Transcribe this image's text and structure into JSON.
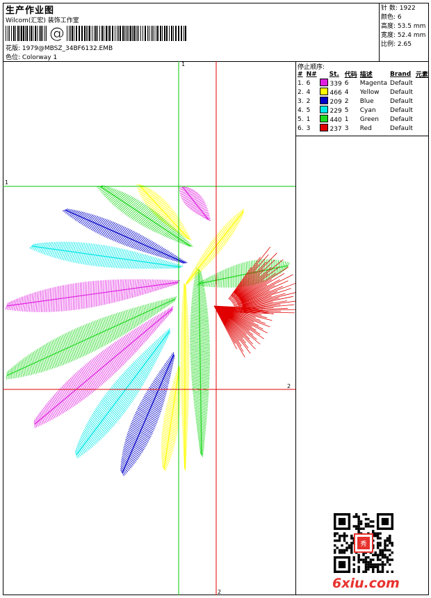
{
  "header": {
    "title": "生产作业图",
    "company": "Wilcom(汇宏) 装饰工作室",
    "design_label": "花版:",
    "design_value": "1979@MBSZ_34BF6132.EMB",
    "colorway_label": "色位:",
    "colorway_value": "Colorway 1"
  },
  "specs": [
    {
      "label": "针 数:",
      "value": "1922"
    },
    {
      "label": "颜色:",
      "value": "6"
    },
    {
      "label": "高度:",
      "value": "53.5 mm"
    },
    {
      "label": "宽度:",
      "value": "52.4 mm"
    },
    {
      "label": "比例:",
      "value": "2.65"
    }
  ],
  "stop_sequence": {
    "title": "停止顺序:",
    "columns": [
      "#",
      "N#",
      "St.",
      "代码",
      "描述",
      "Brand",
      "元素"
    ],
    "rows": [
      {
        "num": "1.",
        "n": "6",
        "swatch": "#e020e0",
        "st": "339",
        "code": "6",
        "desc": "Magenta",
        "brand": "Default"
      },
      {
        "num": "2.",
        "n": "4",
        "swatch": "#ffff00",
        "st": "466",
        "code": "4",
        "desc": "Yellow",
        "brand": "Default"
      },
      {
        "num": "3.",
        "n": "2",
        "swatch": "#0000c8",
        "st": "209",
        "code": "2",
        "desc": "Blue",
        "brand": "Default"
      },
      {
        "num": "4.",
        "n": "5",
        "swatch": "#00e8e8",
        "st": "229",
        "code": "5",
        "desc": "Cyan",
        "brand": "Default"
      },
      {
        "num": "5.",
        "n": "1",
        "swatch": "#20d820",
        "st": "440",
        "code": "1",
        "desc": "Green",
        "brand": "Default"
      },
      {
        "num": "6.",
        "n": "3",
        "swatch": "#e00000",
        "st": "237",
        "code": "3",
        "desc": "Red",
        "brand": "Default"
      }
    ]
  },
  "guides": {
    "green_vertical": "1",
    "green_horizontal": "1",
    "red_horizontal": "2",
    "red_vertical": "2"
  },
  "colors": {
    "green_guide": "#00c800",
    "red_guide": "#e00000"
  },
  "watermark": "6xiu.com"
}
